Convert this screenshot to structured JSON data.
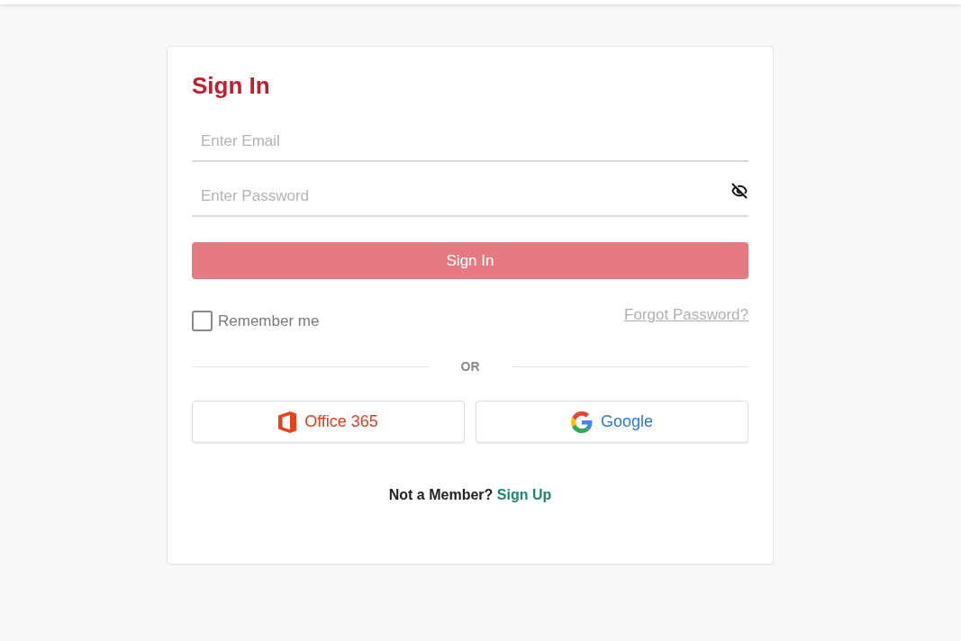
{
  "title": "Sign In",
  "fields": [
    {
      "kind": "email",
      "placeholder": "Enter Email"
    },
    {
      "kind": "password",
      "placeholder": "Enter Password"
    }
  ],
  "submit": {
    "label": "Sign In",
    "disabled": true
  },
  "remember": {
    "label": "Remember me",
    "checked": false
  },
  "forgot": "Forgot Password?",
  "divider": "OR",
  "providers": [
    {
      "kind": "office365",
      "label": "Office 365"
    },
    {
      "kind": "google",
      "label": "Google"
    }
  ],
  "footer": {
    "text": "Not a Member?",
    "link": "Sign Up"
  }
}
